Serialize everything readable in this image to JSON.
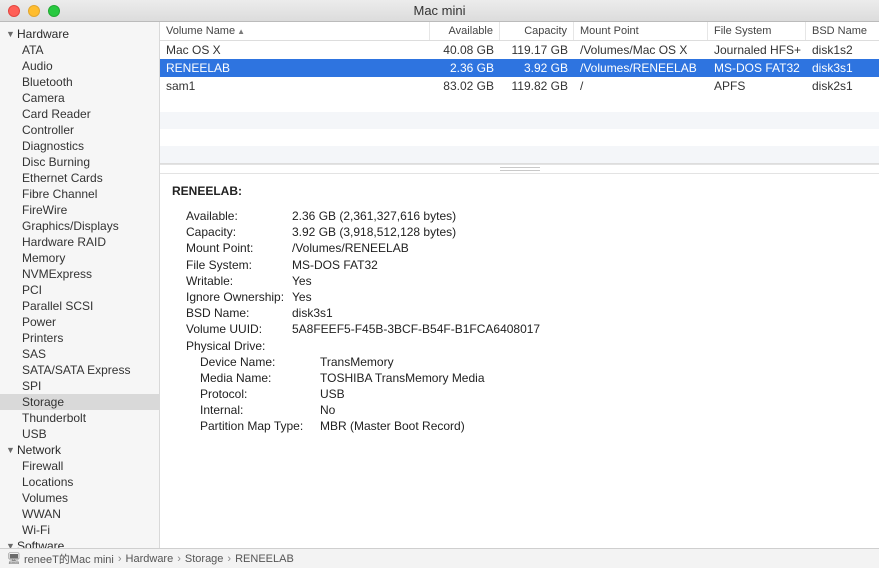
{
  "window": {
    "title": "Mac mini"
  },
  "sidebar": {
    "groups": [
      {
        "label": "Hardware",
        "expanded": true,
        "items": [
          {
            "label": "ATA"
          },
          {
            "label": "Audio"
          },
          {
            "label": "Bluetooth"
          },
          {
            "label": "Camera"
          },
          {
            "label": "Card Reader"
          },
          {
            "label": "Controller"
          },
          {
            "label": "Diagnostics"
          },
          {
            "label": "Disc Burning"
          },
          {
            "label": "Ethernet Cards"
          },
          {
            "label": "Fibre Channel"
          },
          {
            "label": "FireWire"
          },
          {
            "label": "Graphics/Displays"
          },
          {
            "label": "Hardware RAID"
          },
          {
            "label": "Memory"
          },
          {
            "label": "NVMExpress"
          },
          {
            "label": "PCI"
          },
          {
            "label": "Parallel SCSI"
          },
          {
            "label": "Power"
          },
          {
            "label": "Printers"
          },
          {
            "label": "SAS"
          },
          {
            "label": "SATA/SATA Express"
          },
          {
            "label": "SPI"
          },
          {
            "label": "Storage",
            "selected": true
          },
          {
            "label": "Thunderbolt"
          },
          {
            "label": "USB"
          }
        ]
      },
      {
        "label": "Network",
        "expanded": true,
        "items": [
          {
            "label": "Firewall"
          },
          {
            "label": "Locations"
          },
          {
            "label": "Volumes"
          },
          {
            "label": "WWAN"
          },
          {
            "label": "Wi-Fi"
          }
        ]
      },
      {
        "label": "Software",
        "expanded": true,
        "items": []
      }
    ]
  },
  "table": {
    "columns": [
      "Volume Name",
      "Available",
      "Capacity",
      "Mount Point",
      "File System",
      "BSD Name"
    ],
    "sort_col": 0,
    "rows": [
      {
        "cells": [
          "Mac OS X",
          "40.08 GB",
          "119.17 GB",
          "/Volumes/Mac OS X",
          "Journaled HFS+",
          "disk1s2"
        ],
        "selected": false
      },
      {
        "cells": [
          "RENEELAB",
          "2.36 GB",
          "3.92 GB",
          "/Volumes/RENEELAB",
          "MS-DOS FAT32",
          "disk3s1"
        ],
        "selected": true
      },
      {
        "cells": [
          "sam1",
          "83.02 GB",
          "119.82 GB",
          "/",
          "APFS",
          "disk2s1"
        ],
        "selected": false
      }
    ]
  },
  "detail": {
    "heading": "RENEELAB:",
    "fields": [
      {
        "k": "Available:",
        "v": "2.36 GB (2,361,327,616 bytes)"
      },
      {
        "k": "Capacity:",
        "v": "3.92 GB (3,918,512,128 bytes)"
      },
      {
        "k": "Mount Point:",
        "v": "/Volumes/RENEELAB"
      },
      {
        "k": "File System:",
        "v": "MS-DOS FAT32"
      },
      {
        "k": "Writable:",
        "v": "Yes"
      },
      {
        "k": "Ignore Ownership:",
        "v": "Yes"
      },
      {
        "k": "BSD Name:",
        "v": "disk3s1"
      },
      {
        "k": "Volume UUID:",
        "v": "5A8FEEF5-F45B-3BCF-B54F-B1FCA6408017"
      }
    ],
    "physical_label": "Physical Drive:",
    "physical": [
      {
        "k": "Device Name:",
        "v": "TransMemory"
      },
      {
        "k": "Media Name:",
        "v": "TOSHIBA TransMemory Media"
      },
      {
        "k": "Protocol:",
        "v": "USB"
      },
      {
        "k": "Internal:",
        "v": "No"
      },
      {
        "k": "Partition Map Type:",
        "v": "MBR (Master Boot Record)"
      }
    ]
  },
  "breadcrumb": {
    "items": [
      "reneeT的Mac mini",
      "Hardware",
      "Storage",
      "RENEELAB"
    ]
  }
}
